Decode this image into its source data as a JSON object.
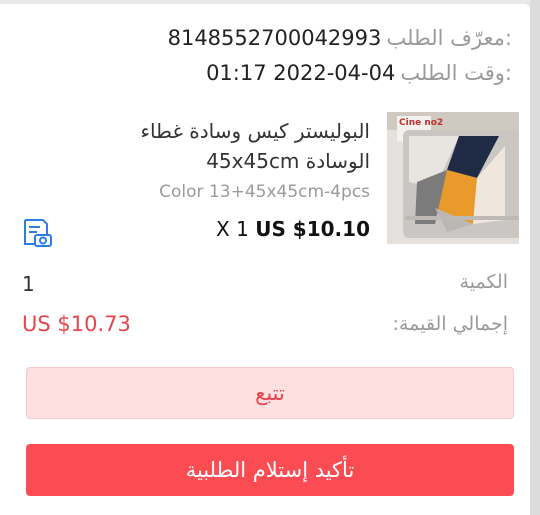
{
  "order": {
    "id_label": "معرّف الطلب:",
    "id_value": "8148552700042993",
    "time_label": "وقت الطلب:",
    "time_value": "01:17 2022-04-04"
  },
  "product": {
    "name": "البوليستر كيس وسادة غطاء الوسادة 45x45cm",
    "variant": "Color 13+45x45cm-4pcs",
    "qty_prefix": "X 1",
    "price": "US $10.10",
    "image_icon": "pillow-cover-thumbnail",
    "thumb_text": "Cine no2"
  },
  "summary": {
    "quantity_label": "الكمية",
    "quantity_value": "1",
    "total_label": "إجمالي القيمة:",
    "total_value": "US $10.73"
  },
  "actions": {
    "track_label": "تتبع",
    "confirm_label": "تأكيد إستلام الطلبية"
  },
  "colors": {
    "accent": "#fb4c54",
    "price_red": "#e6454b",
    "track_bg": "#fde0e0",
    "icon_blue": "#2f7de1"
  }
}
